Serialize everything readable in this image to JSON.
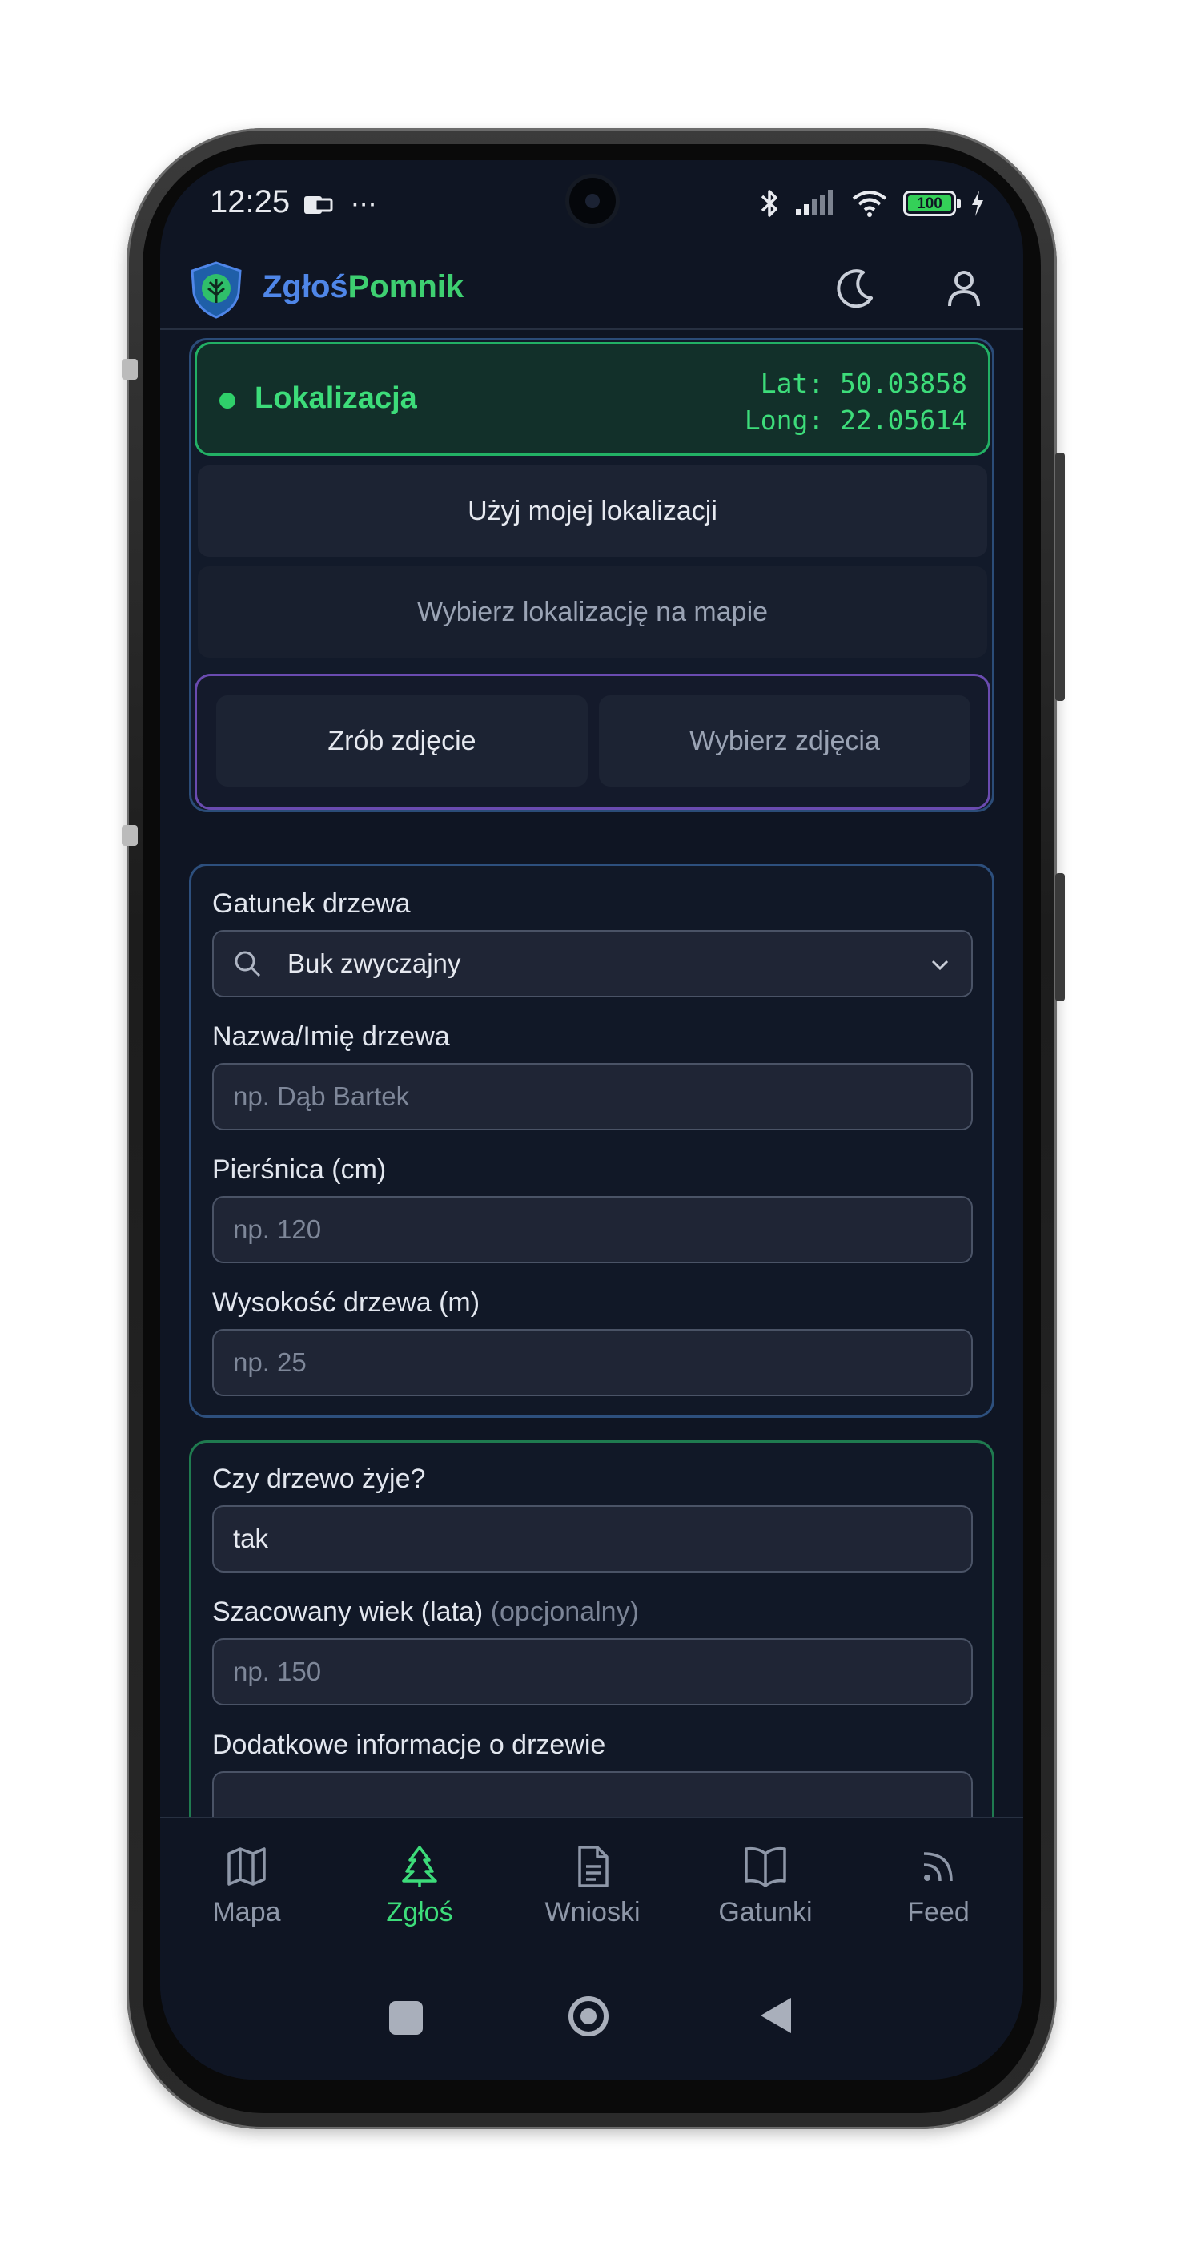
{
  "status_bar": {
    "time": "12:25",
    "more": "···",
    "battery": "100"
  },
  "app": {
    "brand_part1": "Zgłoś",
    "brand_part2": "Pomnik"
  },
  "location": {
    "title": "Lokalizacja",
    "lat": "Lat: 50.03858",
    "long": "Long: 22.05614",
    "use_my_location": "Użyj mojej lokalizacji",
    "choose_on_map": "Wybierz lokalizację na mapie"
  },
  "photos": {
    "take_photo": "Zrób zdjęcie",
    "choose_photos": "Wybierz zdjęcia"
  },
  "tree_form": {
    "species_label": "Gatunek drzewa",
    "species_value": "Buk zwyczajny",
    "name_label": "Nazwa/Imię drzewa",
    "name_placeholder": "np. Dąb Bartek",
    "circumference_label": "Pierśnica (cm)",
    "circumference_placeholder": "np. 120",
    "height_label": "Wysokość drzewa (m)",
    "height_placeholder": "np. 25"
  },
  "tree_details": {
    "alive_label": "Czy drzewo żyje?",
    "alive_value": "tak",
    "age_label": "Szacowany wiek (lata)",
    "age_optional": "(opcjonalny)",
    "age_placeholder": "np. 150",
    "extra_label": "Dodatkowe informacje o drzewie"
  },
  "bottom_nav": [
    {
      "label": "Mapa",
      "icon": "map-icon"
    },
    {
      "label": "Zgłoś",
      "icon": "tree-icon",
      "active": true
    },
    {
      "label": "Wnioski",
      "icon": "document-icon"
    },
    {
      "label": "Gatunki",
      "icon": "book-icon"
    },
    {
      "label": "Feed",
      "icon": "rss-icon"
    }
  ],
  "colors": {
    "accent_green": "#3ddc7a",
    "accent_blue": "#4f86e8",
    "background": "#0f1523"
  }
}
